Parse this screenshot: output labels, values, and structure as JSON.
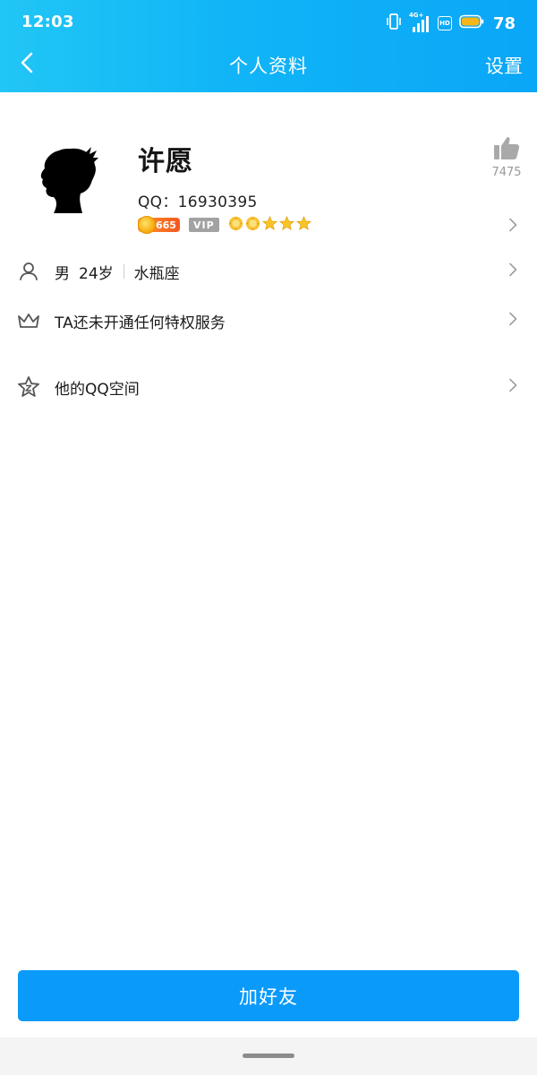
{
  "status_bar": {
    "time": "12:03",
    "network_label": "4G+",
    "hd_label": "HD",
    "battery_level": "78",
    "icons": [
      "vibrate-icon",
      "signal-icon",
      "hd-icon",
      "battery-icon"
    ]
  },
  "nav": {
    "title": "个人资料",
    "settings_label": "设置",
    "back_icon": "chevron-left-icon"
  },
  "profile": {
    "nickname": "许愿",
    "qq_label": "QQ：",
    "qq_number": "16930395",
    "level_number": "665",
    "vip_label": "VIP",
    "like_count": "7475",
    "level_icons": [
      "sun-icon",
      "sun-icon",
      "star-icon",
      "star-icon",
      "star-icon"
    ]
  },
  "info_rows": {
    "basic": {
      "gender": "男",
      "age": "24岁",
      "zodiac": "水瓶座",
      "icon": "person-icon"
    },
    "privilege": {
      "label": "TA还未开通任何特权服务",
      "icon": "crown-icon"
    },
    "qzone": {
      "label": "他的QQ空间",
      "icon": "qzone-star-icon"
    }
  },
  "actions": {
    "add_friend_label": "加好友"
  },
  "colors": {
    "header_gradient_start": "#21c6f5",
    "header_gradient_end": "#0aa6f7",
    "primary_button": "#0a9afa",
    "chevron": "#9e9e9e",
    "battery_fill": "#f7b718"
  }
}
